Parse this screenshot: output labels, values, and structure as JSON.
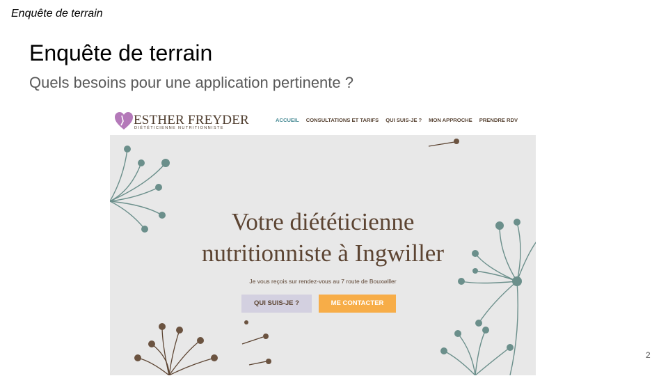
{
  "header": {
    "section_label": "Enquête de terrain"
  },
  "slide": {
    "title": "Enquête de terrain",
    "subtitle": "Quels besoins pour une application pertinente ?",
    "page_number": "2"
  },
  "website": {
    "logo": {
      "name": "ESTHER FREYDER",
      "tagline": "DIÉTÉTICIENNE NUTRITIONNISTE",
      "heart_color": "#b479b9"
    },
    "nav": [
      {
        "label": "ACCUEIL",
        "active": true
      },
      {
        "label": "CONSULTATIONS ET TARIFS",
        "active": false
      },
      {
        "label": "QUI SUIS-JE ?",
        "active": false
      },
      {
        "label": "MON APPROCHE",
        "active": false
      },
      {
        "label": "PRENDRE RDV",
        "active": false
      }
    ],
    "hero": {
      "title_line1": "Votre diététicienne",
      "title_line2": "nutritionniste à Ingwiller",
      "text": "Je vous reçois sur rendez-vous au 7 route de Bouxwiller",
      "button_primary": "QUI SUIS-JE ?",
      "button_secondary": "ME CONTACTER"
    },
    "colors": {
      "hero_bg": "#e8e8e8",
      "brown": "#5c4432",
      "teal": "#6b8f8b",
      "orange": "#f7ad48",
      "lavender": "#d3d0e0",
      "accent_nav": "#4b8d97"
    }
  }
}
